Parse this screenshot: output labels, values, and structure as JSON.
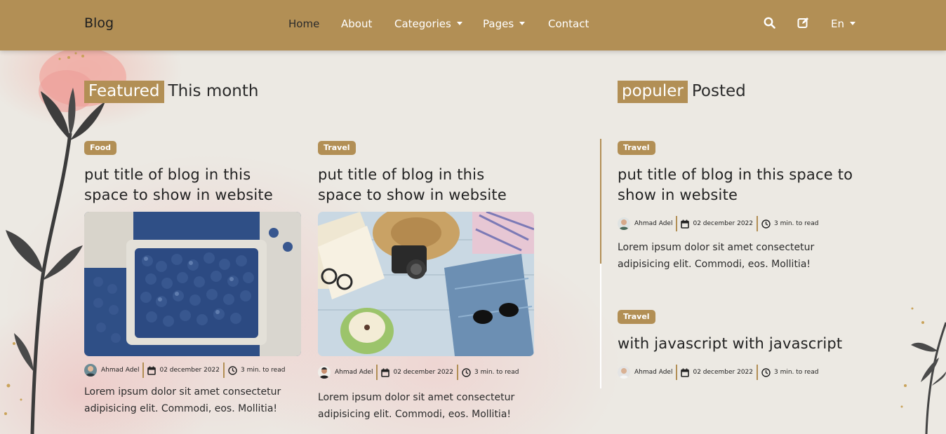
{
  "navbar": {
    "brand": "Blog",
    "links": [
      "Home",
      "About",
      "Categories",
      "Pages",
      "Contact"
    ],
    "language": "En",
    "icons": [
      "search-icon",
      "edit-icon"
    ],
    "color": "#b28f55"
  },
  "featured": {
    "highlight": "Featured",
    "rest": "This month",
    "posts": [
      {
        "category": "Food",
        "title": "put title of blog in this space to show in website",
        "image": "blueberries",
        "author": "Ahmad Adel",
        "date": "02 december 2022",
        "read_time": "3 min. to read",
        "excerpt": "Lorem ipsum dolor sit amet consectetur adipisicing elit. Commodi, eos. Mollitia!"
      },
      {
        "category": "Travel",
        "title": "put title of blog in this space to show in website",
        "image": "travel flat-lay",
        "author": "Ahmad Adel",
        "date": "02 december 2022",
        "read_time": "3 min. to read",
        "excerpt": "Lorem ipsum dolor sit amet consectetur adipisicing elit. Commodi, eos. Mollitia!"
      }
    ]
  },
  "popular": {
    "highlight": "populer",
    "rest": "Posted",
    "posts": [
      {
        "category": "Travel",
        "title": "put title of blog in this space to show in website",
        "author": "Ahmad Adel",
        "date": "02 december 2022",
        "read_time": "3 min. to read",
        "excerpt": "Lorem ipsum dolor sit amet consectetur adipisicing elit. Commodi, eos. Mollitia!"
      },
      {
        "category": "Travel",
        "title": "with javascript with javascript",
        "author": "Ahmad Adel",
        "date": "02 december 2022",
        "read_time": "3 min. to read"
      }
    ]
  },
  "colors": {
    "accent": "#b28f55",
    "background": "#ece9e3"
  }
}
